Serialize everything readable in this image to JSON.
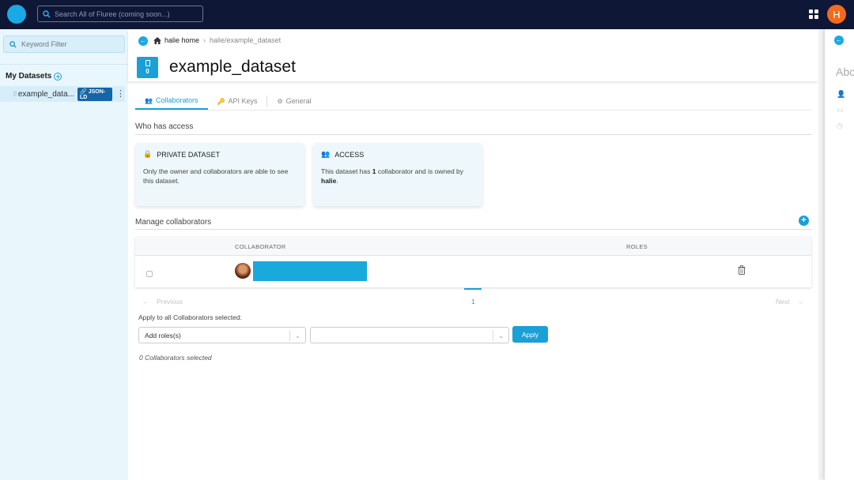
{
  "topbar": {
    "search_placeholder": "Search All of Fluree (coming soon...)",
    "avatar_letter": "H"
  },
  "sidebar": {
    "filter_placeholder": "Keyword Filter",
    "my_datasets_label": "My Datasets",
    "datasets": [
      {
        "name": "example_data...",
        "badge": "JSON-LD"
      }
    ]
  },
  "header": {
    "breadcrumb_home": "halie home",
    "breadcrumb_current": "halie/example_dataset",
    "dataset_count": "0",
    "title": "example_dataset"
  },
  "tabs": [
    {
      "label": "Collaborators",
      "icon": "users-icon",
      "active": true
    },
    {
      "label": "API Keys",
      "icon": "key-icon",
      "active": false
    },
    {
      "label": "General",
      "icon": "gear-icon",
      "active": false
    }
  ],
  "access": {
    "section_title": "Who has access",
    "private_card": {
      "heading": "PRIVATE DATASET",
      "text": "Only the owner and collaborators are able to see this dataset."
    },
    "access_card": {
      "heading": "ACCESS",
      "text_prefix": "This dataset has ",
      "collaborator_count": "1",
      "text_middle": " collaborator and is owned by ",
      "owner": "halie",
      "text_suffix": "."
    }
  },
  "collaborators": {
    "section_title": "Manage collaborators",
    "columns": [
      "COLLABORATOR",
      "ROLES"
    ],
    "rows": [
      {
        "name_redacted": true
      }
    ]
  },
  "pagination": {
    "prev_label": "Previous",
    "current_page": "1",
    "next_label": "Next"
  },
  "bulk": {
    "label": "Apply to all Collaborators selected:",
    "roles_placeholder": "Add roles(s)",
    "second_select_value": "",
    "apply_label": "Apply",
    "selected_count_text": "0 Collaborators selected"
  },
  "right_panel": {
    "title_partial": "Abo"
  },
  "colors": {
    "nav_bg": "#0f1737",
    "accent": "#1a9fd6",
    "sidebar_bg": "#e9f6fc"
  }
}
